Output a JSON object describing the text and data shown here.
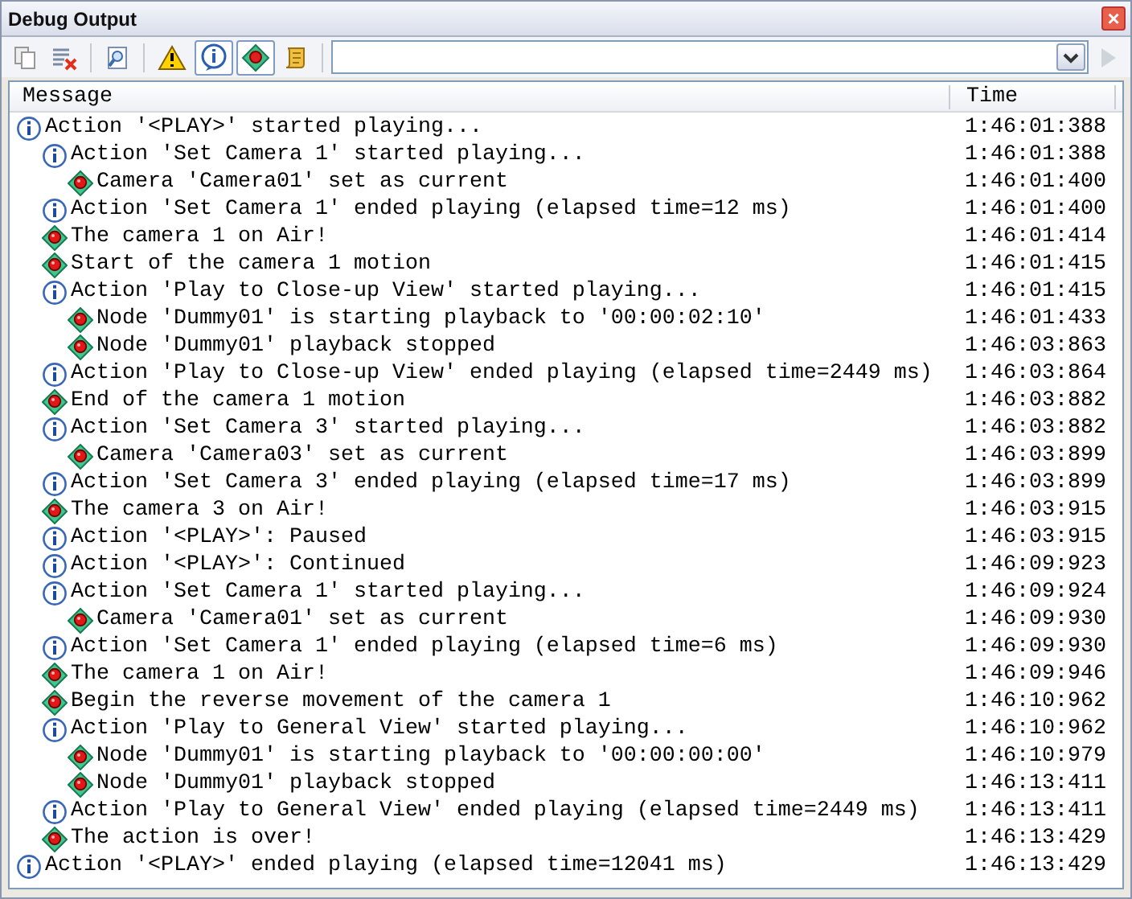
{
  "window": {
    "title": "Debug Output",
    "close": "×"
  },
  "toolbar": {
    "filters": [
      {
        "kind": "warning",
        "pressed": false
      },
      {
        "kind": "info",
        "pressed": true
      },
      {
        "kind": "event",
        "pressed": true
      },
      {
        "kind": "script",
        "pressed": false
      }
    ]
  },
  "table": {
    "columns": [
      "Message",
      "Time"
    ],
    "rows": [
      {
        "kind": "info",
        "message": "Action '<PLAY>' started playing...",
        "time": "1:46:01:388",
        "children": [
          {
            "kind": "info",
            "message": "Action 'Set Camera 1' started playing...",
            "time": "1:46:01:388",
            "children": [
              {
                "kind": "event",
                "message": "Camera 'Camera01' set as current",
                "time": "1:46:01:400"
              }
            ]
          },
          {
            "kind": "info",
            "message": "Action 'Set Camera 1' ended playing (elapsed time=12 ms)",
            "time": "1:46:01:400"
          },
          {
            "kind": "event",
            "message": "The camera 1 on Air!",
            "time": "1:46:01:414"
          },
          {
            "kind": "event",
            "message": "Start of the camera 1 motion",
            "time": "1:46:01:415"
          },
          {
            "kind": "info",
            "message": "Action 'Play to Close-up View' started playing...",
            "time": "1:46:01:415",
            "children": [
              {
                "kind": "event",
                "message": "Node 'Dummy01' is starting playback to '00:00:02:10'",
                "time": "1:46:01:433"
              },
              {
                "kind": "event",
                "message": "Node 'Dummy01' playback stopped",
                "time": "1:46:03:863"
              }
            ]
          },
          {
            "kind": "info",
            "message": "Action 'Play to Close-up View' ended playing (elapsed time=2449 ms)",
            "time": "1:46:03:864"
          },
          {
            "kind": "event",
            "message": "End of the camera 1 motion",
            "time": "1:46:03:882"
          },
          {
            "kind": "info",
            "message": "Action 'Set Camera 3' started playing...",
            "time": "1:46:03:882",
            "children": [
              {
                "kind": "event",
                "message": "Camera 'Camera03' set as current",
                "time": "1:46:03:899"
              }
            ]
          },
          {
            "kind": "info",
            "message": "Action 'Set Camera 3' ended playing (elapsed time=17 ms)",
            "time": "1:46:03:899"
          },
          {
            "kind": "event",
            "message": "The camera 3 on Air!",
            "time": "1:46:03:915"
          },
          {
            "kind": "info",
            "message": "Action '<PLAY>': Paused",
            "time": "1:46:03:915"
          },
          {
            "kind": "info",
            "message": "Action '<PLAY>': Continued",
            "time": "1:46:09:923"
          },
          {
            "kind": "info",
            "message": "Action 'Set Camera 1' started playing...",
            "time": "1:46:09:924",
            "children": [
              {
                "kind": "event",
                "message": "Camera 'Camera01' set as current",
                "time": "1:46:09:930"
              }
            ]
          },
          {
            "kind": "info",
            "message": "Action 'Set Camera 1' ended playing (elapsed time=6 ms)",
            "time": "1:46:09:930"
          },
          {
            "kind": "event",
            "message": "The camera 1 on Air!",
            "time": "1:46:09:946"
          },
          {
            "kind": "event",
            "message": "Begin the reverse movement of the camera 1",
            "time": "1:46:10:962"
          },
          {
            "kind": "info",
            "message": "Action 'Play to General View' started playing...",
            "time": "1:46:10:962",
            "children": [
              {
                "kind": "event",
                "message": "Node 'Dummy01' is starting playback to '00:00:00:00'",
                "time": "1:46:10:979"
              },
              {
                "kind": "event",
                "message": "Node 'Dummy01' playback stopped",
                "time": "1:46:13:411"
              }
            ]
          },
          {
            "kind": "info",
            "message": "Action 'Play to General View' ended playing (elapsed time=2449 ms)",
            "time": "1:46:13:411"
          },
          {
            "kind": "event",
            "message": "The action is over!",
            "time": "1:46:13:429"
          }
        ]
      },
      {
        "kind": "info",
        "message": "Action '<PLAY>' ended playing (elapsed time=12041 ms)",
        "time": "1:46:13:429"
      }
    ]
  }
}
